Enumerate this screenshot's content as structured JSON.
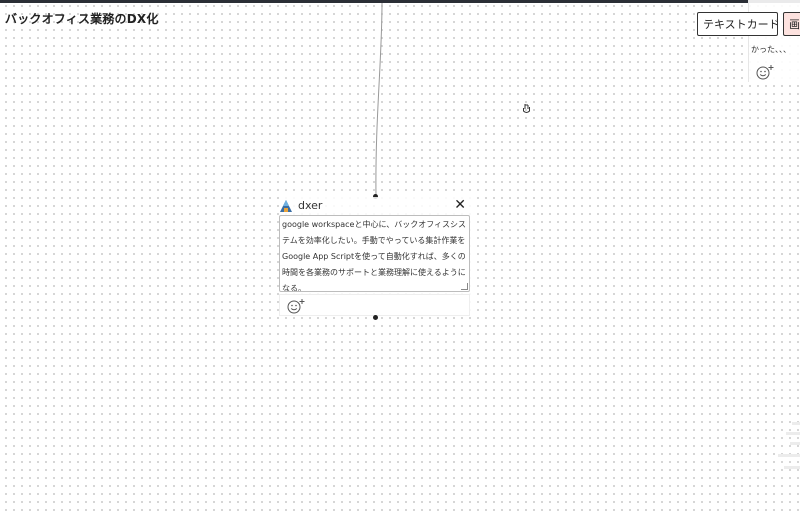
{
  "board": {
    "title": "バックオフィス業務のDX化"
  },
  "card": {
    "user": "dxer",
    "text": "google workspaceと中心に、バックオフィスシステムを効率化したい。手動でやっている集計作業をGoogle App Scriptを使って自動化すれば、多くの時間を各業務のサポートと業務理解に使えるようになる。",
    "close_icon": "close-icon",
    "reaction_icon": "add-reaction-icon"
  },
  "toolbar": {
    "text_card_label": "テキストカード",
    "image_card_label": "画像"
  },
  "side_card": {
    "snippet": "かった、、、",
    "reaction_icon": "add-reaction-icon"
  }
}
